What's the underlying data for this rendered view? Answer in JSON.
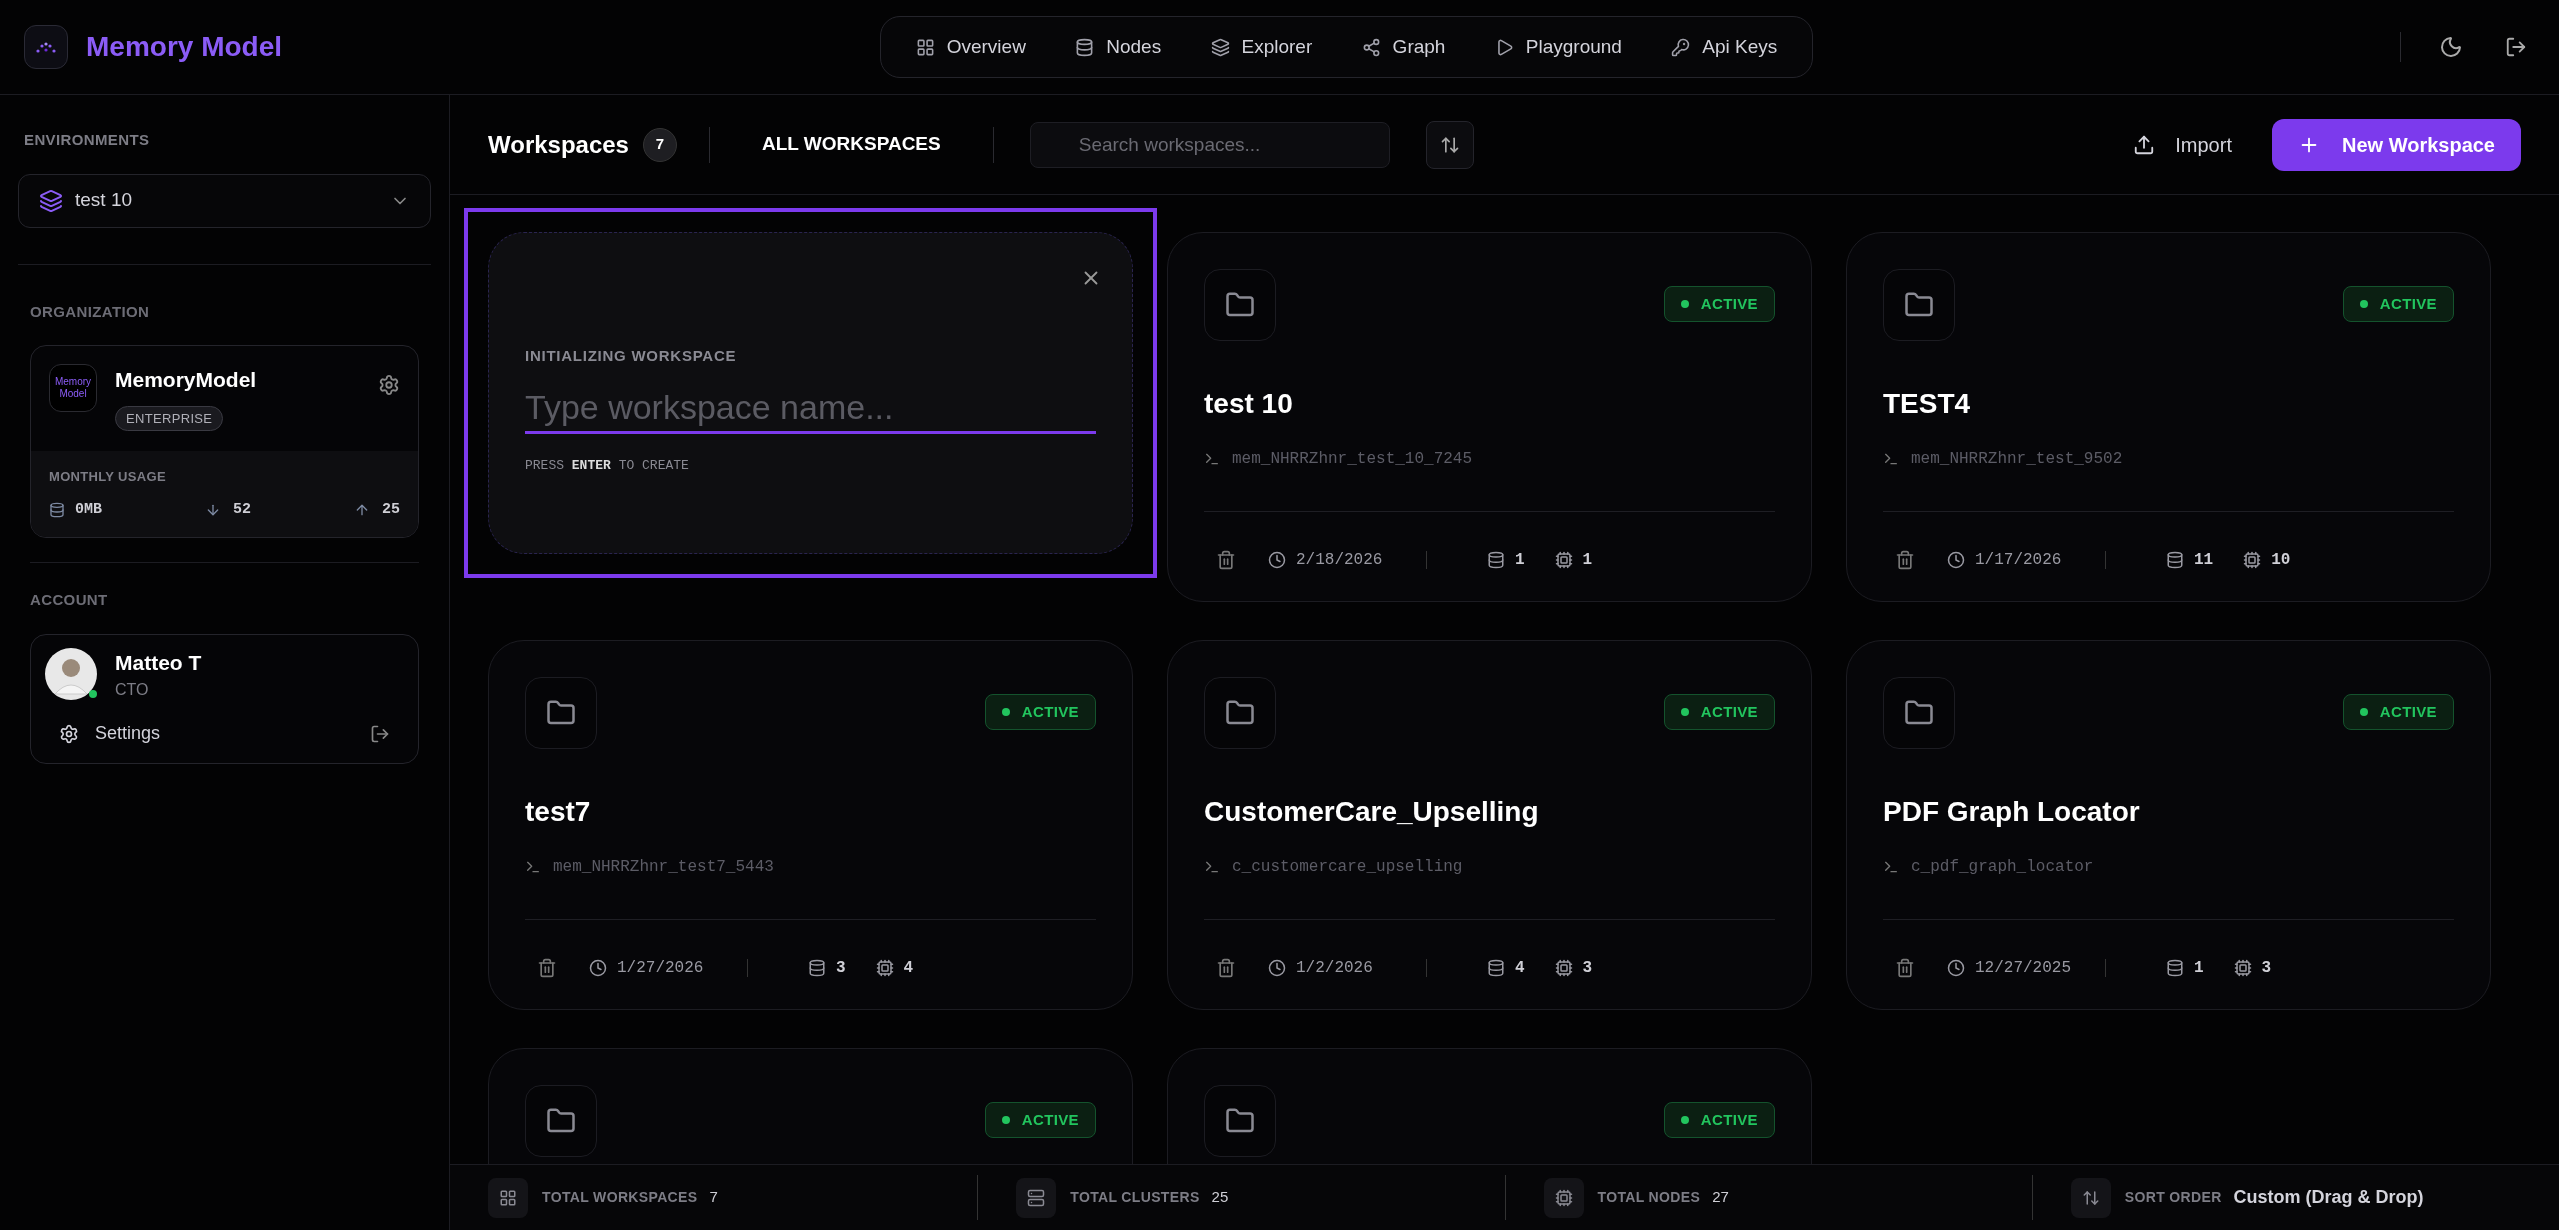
{
  "app": {
    "name": "Memory Model"
  },
  "nav": [
    {
      "label": "Overview",
      "kind": "grid"
    },
    {
      "label": "Nodes",
      "kind": "database"
    },
    {
      "label": "Explorer",
      "kind": "layers"
    },
    {
      "label": "Graph",
      "kind": "share"
    },
    {
      "label": "Playground",
      "kind": "play"
    },
    {
      "label": "Api Keys",
      "kind": "key"
    }
  ],
  "sidebar": {
    "environments_label": "ENVIRONMENTS",
    "environment": "test 10",
    "organization_label": "ORGANIZATION",
    "organization": {
      "logo_text": "Memory Model",
      "name": "MemoryModel",
      "plan": "ENTERPRISE",
      "usage_label": "MONTHLY USAGE",
      "storage": "0MB",
      "down": "52",
      "up": "25"
    },
    "account_label": "ACCOUNT",
    "account": {
      "name": "Matteo T",
      "role": "CTO",
      "online": true,
      "settings": "Settings"
    }
  },
  "toolbar": {
    "title": "Workspaces",
    "count": "7",
    "filter": "ALL WORKSPACES",
    "search_placeholder": "Search workspaces...",
    "import": "Import",
    "new": "New Workspace"
  },
  "new_workspace": {
    "label": "INITIALIZING WORKSPACE",
    "placeholder": "Type workspace name...",
    "hint": "PRESS **ENTER** TO CREATE",
    "focused": true
  },
  "workspaces": [
    {
      "name": "test 10",
      "status": "ACTIVE",
      "path": "mem_NHRRZhnr_test_10_7245",
      "date": "2/18/2026",
      "clusters": "1",
      "nodes": "1"
    },
    {
      "name": "TEST4",
      "status": "ACTIVE",
      "path": "mem_NHRRZhnr_test_9502",
      "date": "1/17/2026",
      "clusters": "11",
      "nodes": "10"
    },
    {
      "name": "test7",
      "status": "ACTIVE",
      "path": "mem_NHRRZhnr_test7_5443",
      "date": "1/27/2026",
      "clusters": "3",
      "nodes": "4"
    },
    {
      "name": "CustomerCare_Upselling",
      "status": "ACTIVE",
      "path": "c_customercare_upselling",
      "date": "1/2/2026",
      "clusters": "4",
      "nodes": "3"
    },
    {
      "name": "PDF Graph Locator",
      "status": "ACTIVE",
      "path": "c_pdf_graph_locator",
      "date": "12/27/2025",
      "clusters": "1",
      "nodes": "3"
    },
    {
      "status": "ACTIVE"
    },
    {
      "status": "ACTIVE"
    }
  ],
  "footer": [
    {
      "label": "TOTAL WORKSPACES",
      "value": "7",
      "kind": "grid"
    },
    {
      "label": "TOTAL CLUSTERS",
      "value": "25",
      "kind": "server"
    },
    {
      "label": "TOTAL NODES",
      "value": "27",
      "kind": "cpu"
    },
    {
      "label": "SORT ORDER",
      "value": "Custom (Drag & Drop)",
      "kind": "sort"
    }
  ]
}
